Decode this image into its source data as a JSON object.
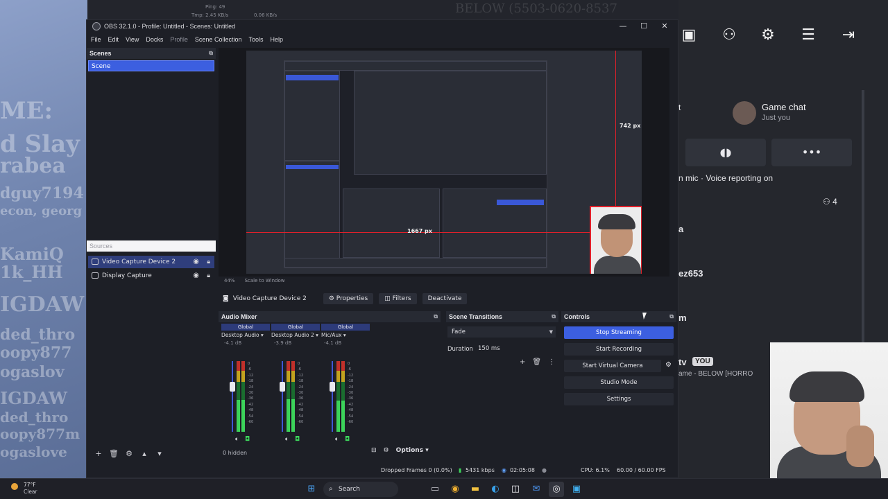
{
  "background": {
    "left_ghost_text": [
      "ME:",
      "d Slay",
      "rabea",
      "dguy7194",
      "econ, georg",
      "KamiQ",
      "1k_HH",
      "IGDAW",
      "ded_thro",
      "oopy877",
      "ogaslov",
      "IGDAW",
      "ded_thro",
      "oopy877m",
      "ogaslove"
    ],
    "top_stats": {
      "ping": "Ping: 49",
      "mem": "Tmp: 2.45 KB/s",
      "bw": "0.06 KB/s"
    },
    "top_overlay_text": "BELOW (5503-0620-8537"
  },
  "right_panel": {
    "toolbar_icons": [
      "chat-icon",
      "add-friend-icon",
      "settings-icon",
      "menu-icon",
      "exit-icon"
    ],
    "game_chat_title": "Game chat",
    "game_chat_sub": "Just you",
    "party_letter": "t",
    "voice_text": "n mic · Voice reporting on",
    "party_count": "4",
    "user_lines": [
      "a",
      "ez653",
      "m",
      "tv"
    ],
    "you_badge": "YOU",
    "game_line": "ame - BELOW [HORRO"
  },
  "obs": {
    "title": "OBS 32.1.0 - Profile: Untitled - Scenes: Untitled",
    "window_buttons": [
      "—",
      "☐",
      "✕"
    ],
    "menu": [
      "File",
      "Edit",
      "View",
      "Docks",
      "Profile",
      "Scene Collection",
      "Tools",
      "Help"
    ],
    "scenes": {
      "title": "Scenes",
      "items": [
        "Scene"
      ]
    },
    "sources": {
      "title": "Sources",
      "items": [
        "Video Capture Device 2",
        "Display Capture"
      ]
    },
    "preview": {
      "zoom": "44%",
      "scale": "Scale to Window",
      "width_label": "1667 px",
      "height_label": "742 px"
    },
    "context": {
      "source": "Video Capture Device 2",
      "properties": "Properties",
      "filters": "Filters",
      "deactivate": "Deactivate"
    },
    "audio_mixer": {
      "title": "Audio Mixer",
      "channels": [
        {
          "tag": "Global",
          "name": "Desktop Audio",
          "db": "-4.1 dB",
          "level": 0.82
        },
        {
          "tag": "Global",
          "name": "Desktop Audio 2",
          "db": "-3.9 dB",
          "level": 0.84
        },
        {
          "tag": "Global",
          "name": "Mic/Aux",
          "db": "-4.1 dB",
          "level": 0.8
        }
      ],
      "scale": [
        "0",
        "-6",
        "-12",
        "-18",
        "-24",
        "-30",
        "-36",
        "-42",
        "-48",
        "-54",
        "-60"
      ],
      "hidden": "0 hidden",
      "options": "Options"
    },
    "transitions": {
      "title": "Scene Transitions",
      "selected": "Fade",
      "duration_label": "Duration",
      "duration_value": "150 ms"
    },
    "controls": {
      "title": "Controls",
      "buttons": [
        "Stop Streaming",
        "Start Recording",
        "Start Virtual Camera",
        "Studio Mode",
        "Settings"
      ]
    },
    "status": {
      "dropped": "Dropped Frames 0 (0.0%)",
      "kbps": "5431 kbps",
      "time": "02:05:08",
      "cpu": "CPU: 6.1%",
      "fps": "60.00 / 60.00 FPS"
    }
  },
  "taskbar": {
    "weather_temp": "77°F",
    "weather_cond": "Clear",
    "search_label": "Search"
  }
}
